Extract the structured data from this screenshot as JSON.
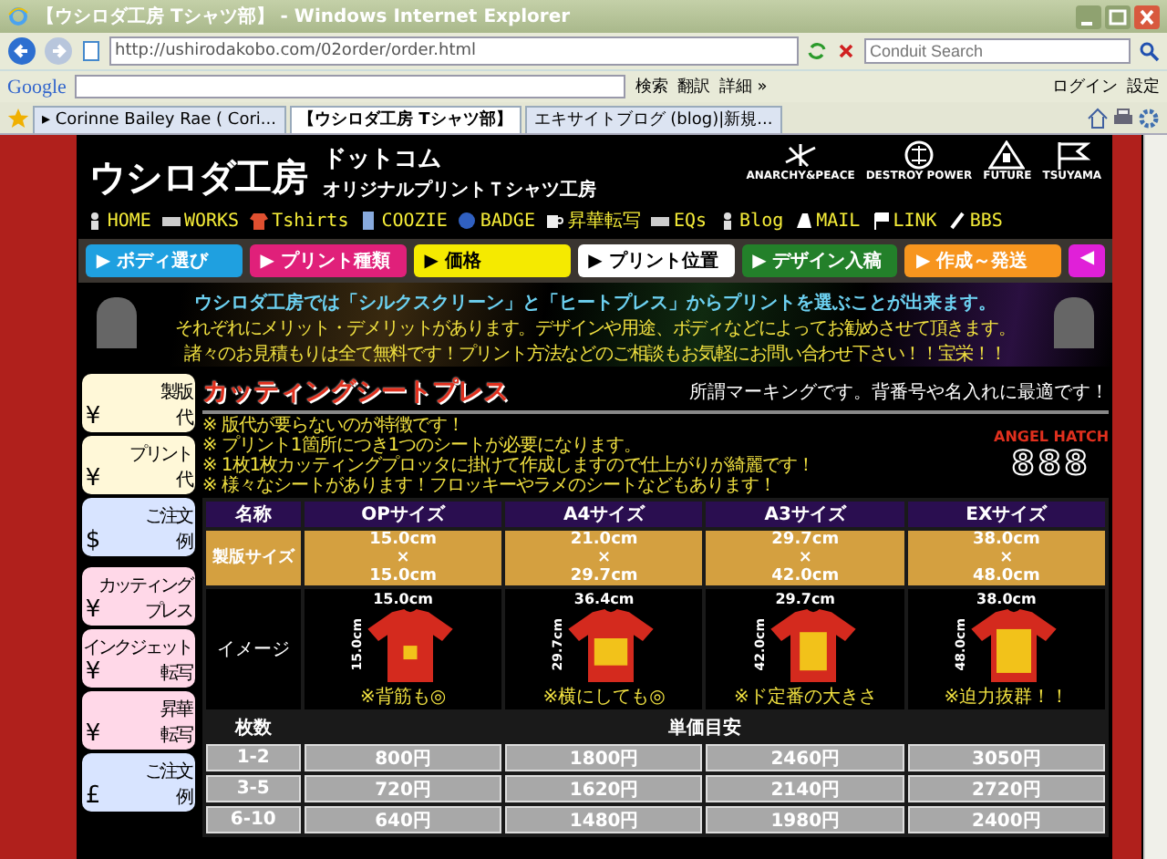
{
  "window": {
    "title": "【ウシロダ工房 Tシャツ部】 - Windows Internet Explorer"
  },
  "address_bar": {
    "url": "http://ushirodakobo.com/02order/order.html",
    "search_placeholder": "Conduit Search"
  },
  "google_toolbar": {
    "logo": "Google",
    "search_button": "検索",
    "translate": "翻訳",
    "more": "詳細 »",
    "login": "ログイン",
    "settings": "設定"
  },
  "tabs": [
    {
      "label": "▸ Corinne Bailey Rae ( Cori...",
      "selected": false
    },
    {
      "label": "【ウシロダ工房 Tシャツ部】",
      "selected": true
    },
    {
      "label": "エキサイトブログ (blog)|新規...",
      "selected": false
    }
  ],
  "header": {
    "logo": "ウシロダ工房",
    "logo_suffix": "ドットコム",
    "tagline": "オリジナルプリントＴシャツ工房",
    "emblems": [
      "ANARCHY&PEACE",
      "DESTROY POWER",
      "FUTURE",
      "TSUYAMA"
    ]
  },
  "nav": [
    "HOME",
    "WORKS",
    "Tshirts",
    "COOZIE",
    "BADGE",
    "昇華転写",
    "EQs",
    "Blog",
    "MAIL",
    "LINK",
    "BBS"
  ],
  "steps": [
    {
      "label": "▶ ボディ選び",
      "color": "#1fa0e0"
    },
    {
      "label": "▶ プリント種類",
      "color": "#e0207a"
    },
    {
      "label": "▶ 価格",
      "color": "#f5ea00"
    },
    {
      "label": "▶ プリント位置",
      "color": "#ffffff"
    },
    {
      "label": "▶ デザイン入稿",
      "color": "#23802a"
    },
    {
      "label": "▶ 作成～発送",
      "color": "#f7951e"
    },
    {
      "label": "◀",
      "color": "#e020d8"
    }
  ],
  "banner": {
    "headline": "ウシロダ工房では「シルクスクリーン」と「ヒートプレス」からプリントを選ぶことが出来ます。",
    "lines": [
      "それぞれにメリット・デメリットがあります。デザインや用途、ボディなどによってお勧めさせて頂きます。",
      "諸々のお見積もりは全て無料です！プリント方法などのご相談もお気軽にお問い合わせ下さい！！宝栄！！"
    ]
  },
  "sidebar": [
    {
      "items": [
        {
          "symbol": "¥",
          "label": [
            "製版",
            "代"
          ],
          "color": "#fff8d8"
        },
        {
          "symbol": "¥",
          "label": [
            "プリント",
            "代"
          ],
          "color": "#fff8d8"
        },
        {
          "symbol": "$",
          "label": [
            "ご注文",
            "例"
          ],
          "color": "#d8e4ff"
        }
      ]
    },
    {
      "items": [
        {
          "symbol": "¥",
          "label": [
            "カッティング",
            "プレス"
          ],
          "color": "#ffd8e8"
        },
        {
          "symbol": "¥",
          "label": [
            "インクジェット",
            "転写"
          ],
          "color": "#ffd8e8"
        },
        {
          "symbol": "¥",
          "label": [
            "昇華",
            "転写"
          ],
          "color": "#ffd8e8"
        },
        {
          "symbol": "£",
          "label": [
            "ご注文",
            "例"
          ],
          "color": "#d8e4ff"
        }
      ]
    }
  ],
  "section": {
    "title": "カッティングシートプレス",
    "note": "所謂マーキングです。背番号や名入れに最適です！",
    "bullets": [
      "※ 版代が要らないのが特徴です！",
      "※ プリント1箇所につき1つのシートが必要になります。",
      "※ 1枚1枚カッティングプロッタに掛けて作成しますので仕上がりが綺麗です！",
      "※ 様々なシートがあります！フロッキーやラメのシートなどもあります！"
    ],
    "badge_arc": "ANGEL HATCH",
    "badge_number": "888"
  },
  "table": {
    "columns": [
      "名称",
      "OPサイズ",
      "A4サイズ",
      "A3サイズ",
      "EXサイズ"
    ],
    "size_row": {
      "label": "製版サイズ",
      "cells": [
        [
          "15.0cm",
          "×",
          "15.0cm"
        ],
        [
          "21.0cm",
          "×",
          "29.7cm"
        ],
        [
          "29.7cm",
          "×",
          "42.0cm"
        ],
        [
          "38.0cm",
          "×",
          "48.0cm"
        ]
      ]
    },
    "image_row": {
      "label": "イメージ",
      "cells": [
        {
          "width": "15.0cm",
          "height": "15.0cm",
          "note": "※背筋も◎"
        },
        {
          "width": "36.4cm",
          "height": "29.7cm",
          "note": "※横にしても◎"
        },
        {
          "width": "29.7cm",
          "height": "42.0cm",
          "note": "※ド定番の大きさ"
        },
        {
          "width": "38.0cm",
          "height": "48.0cm",
          "note": "※迫力抜群！！"
        }
      ]
    },
    "price_header": [
      "枚数",
      "単価目安"
    ],
    "price_rows": [
      [
        "1-2",
        "800円",
        "1800円",
        "2460円",
        "3050円"
      ],
      [
        "3-5",
        "720円",
        "1620円",
        "2140円",
        "2720円"
      ],
      [
        "6-10",
        "640円",
        "1480円",
        "1980円",
        "2400円"
      ]
    ]
  }
}
